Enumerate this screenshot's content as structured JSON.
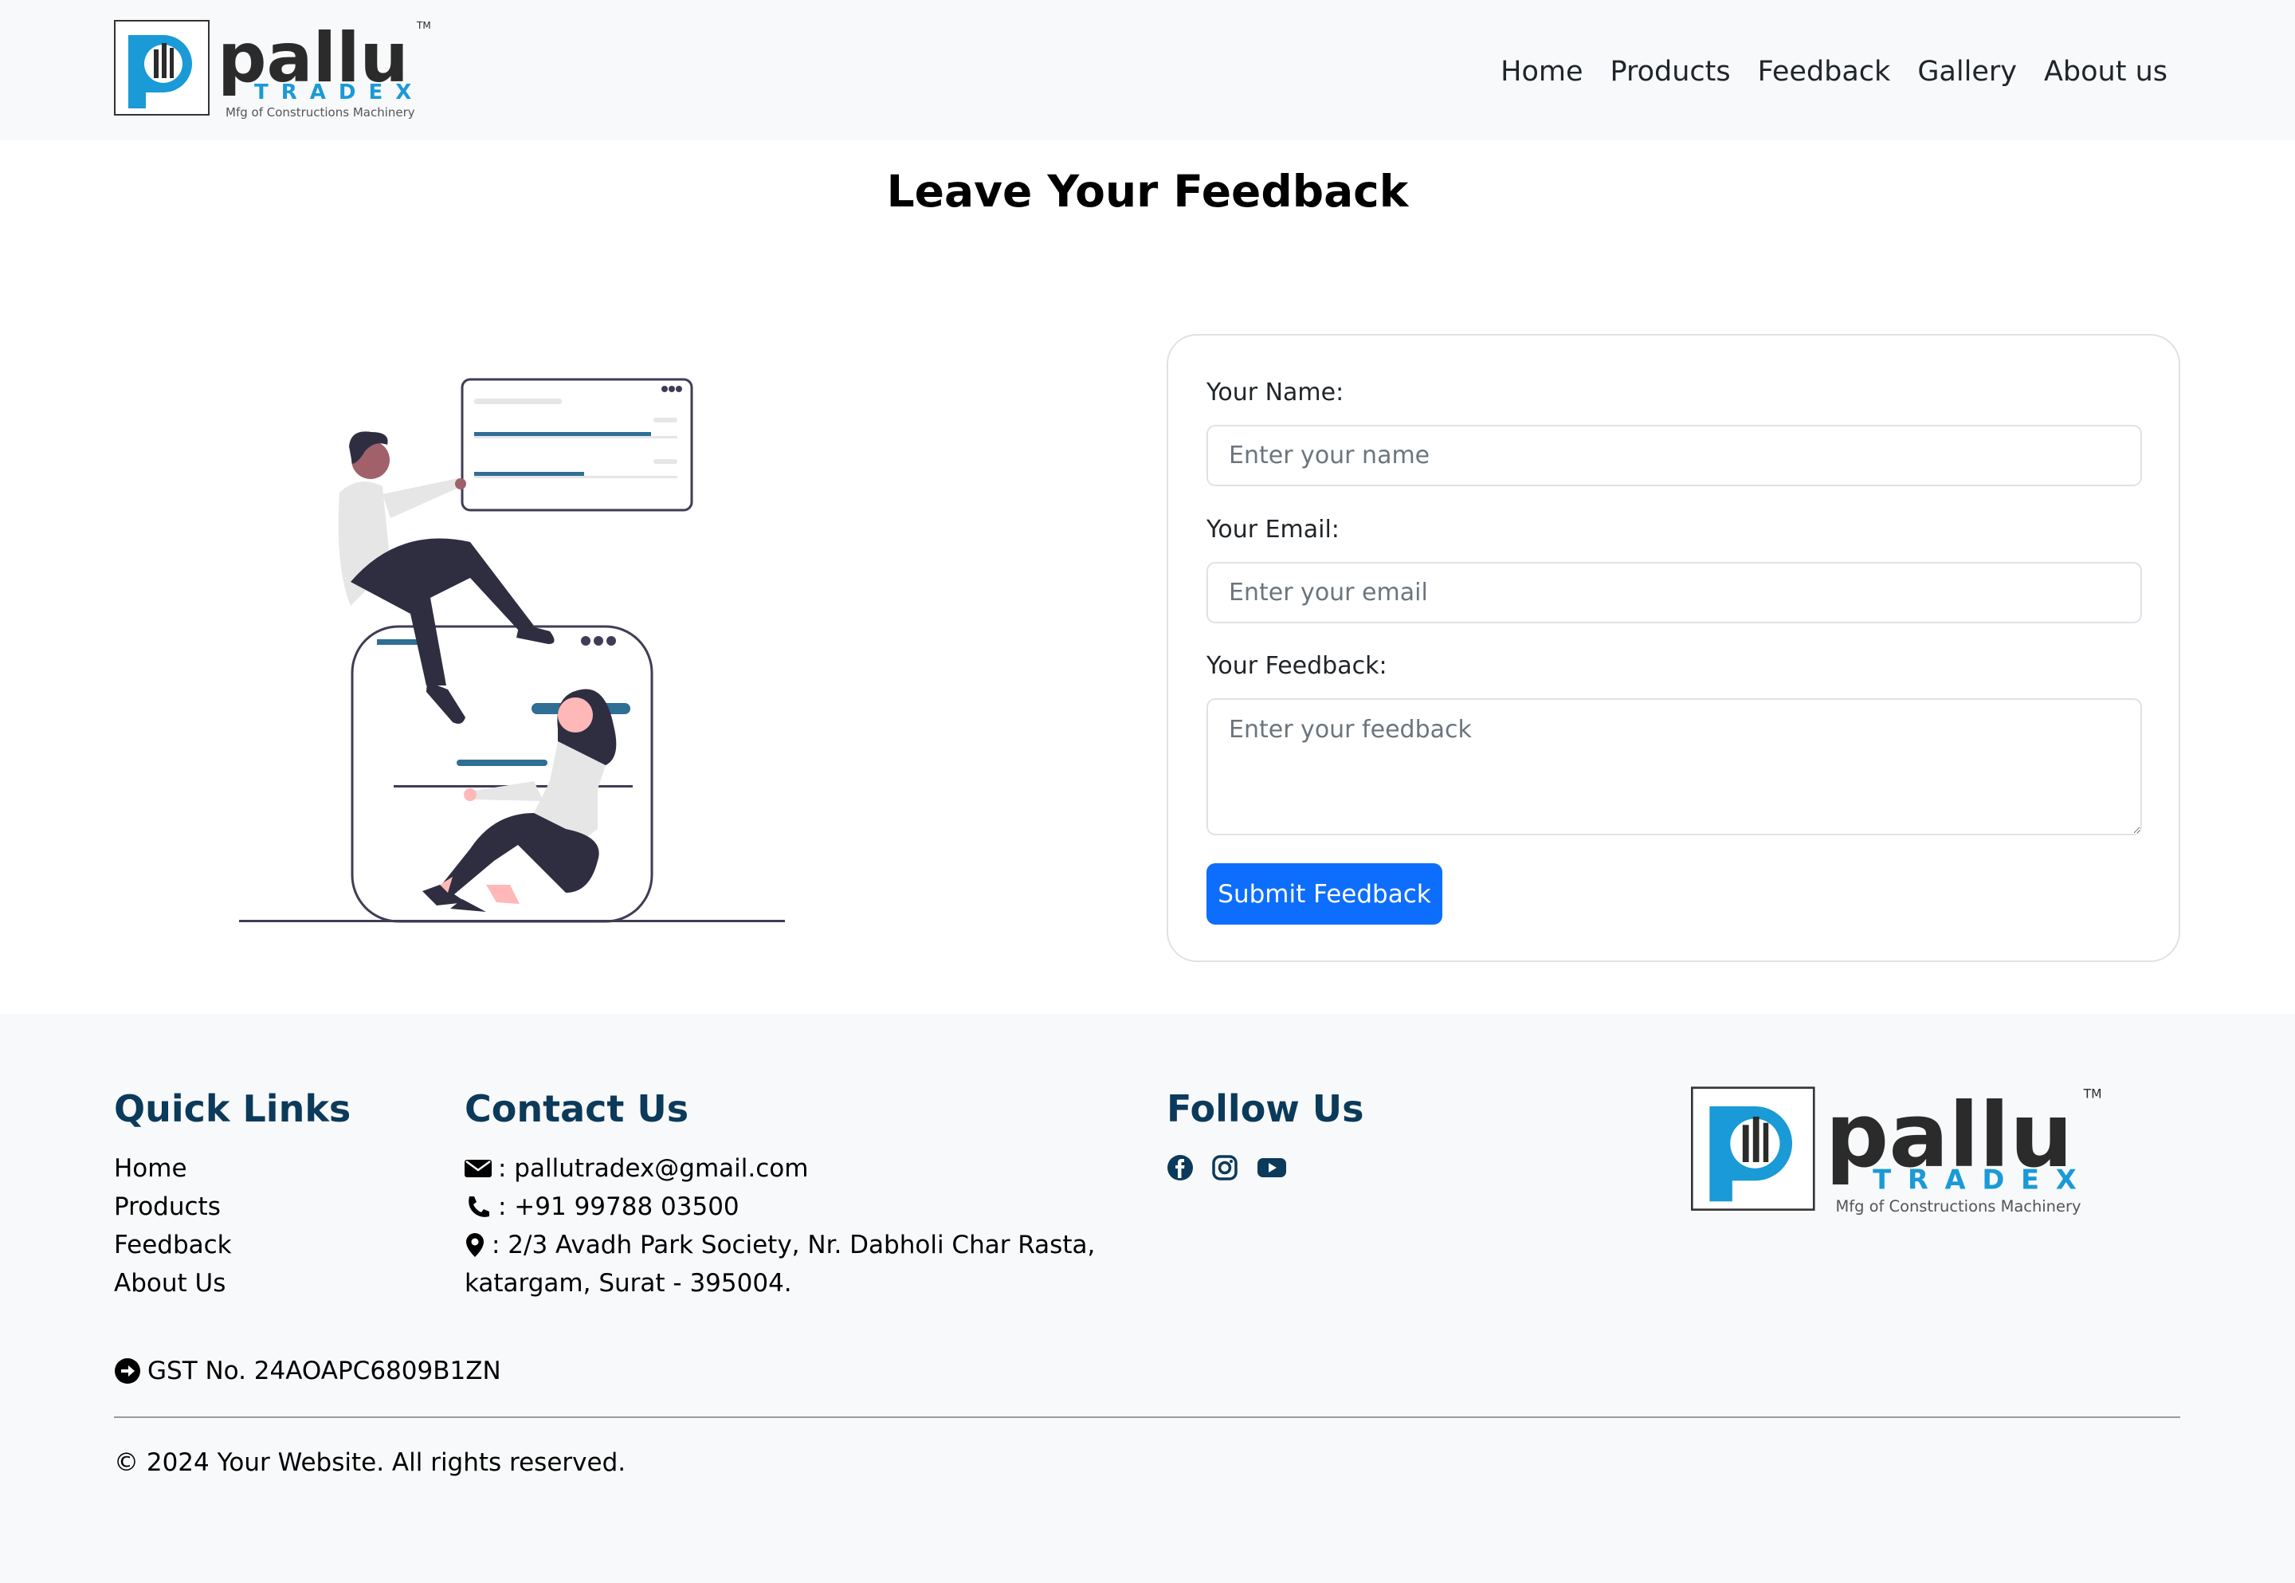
{
  "brand": {
    "name": "pallu",
    "sub": "TRADEX",
    "tagline": "Mfg of Constructions Machinery",
    "tm": "TM",
    "colors": {
      "dark": "#2b2b2b",
      "blue": "#1a9ad6"
    }
  },
  "nav": {
    "items": [
      {
        "label": "Home"
      },
      {
        "label": "Products"
      },
      {
        "label": "Feedback"
      },
      {
        "label": "Gallery"
      },
      {
        "label": "About us"
      }
    ]
  },
  "page": {
    "title": "Leave Your Feedback"
  },
  "form": {
    "name_label": "Your Name:",
    "name_placeholder": "Enter your name",
    "email_label": "Your Email:",
    "email_placeholder": "Enter your email",
    "feedback_label": "Your Feedback:",
    "feedback_placeholder": "Enter your feedback",
    "submit_label": "Submit Feedback",
    "accent": "#0d6efd"
  },
  "footer": {
    "quick_links_title": "Quick Links",
    "quick_links": [
      {
        "label": "Home"
      },
      {
        "label": "Products"
      },
      {
        "label": "Feedback"
      },
      {
        "label": "About Us"
      }
    ],
    "contact_title": "Contact Us",
    "contact": {
      "email": ": pallutradex@gmail.com",
      "phone": ": +91 99788 03500",
      "address_line1": ": 2/3 Avadh Park Society, Nr. Dabholi Char Rasta,",
      "address_line2": "katargam, Surat - 395004."
    },
    "follow_title": "Follow Us",
    "social_icons": [
      "facebook-icon",
      "instagram-icon",
      "youtube-icon"
    ],
    "gst": "GST No. 24AOAPC6809B1ZN",
    "copyright": "© 2024 Your Website. All rights reserved.",
    "heading_color": "#0b3a5b"
  }
}
